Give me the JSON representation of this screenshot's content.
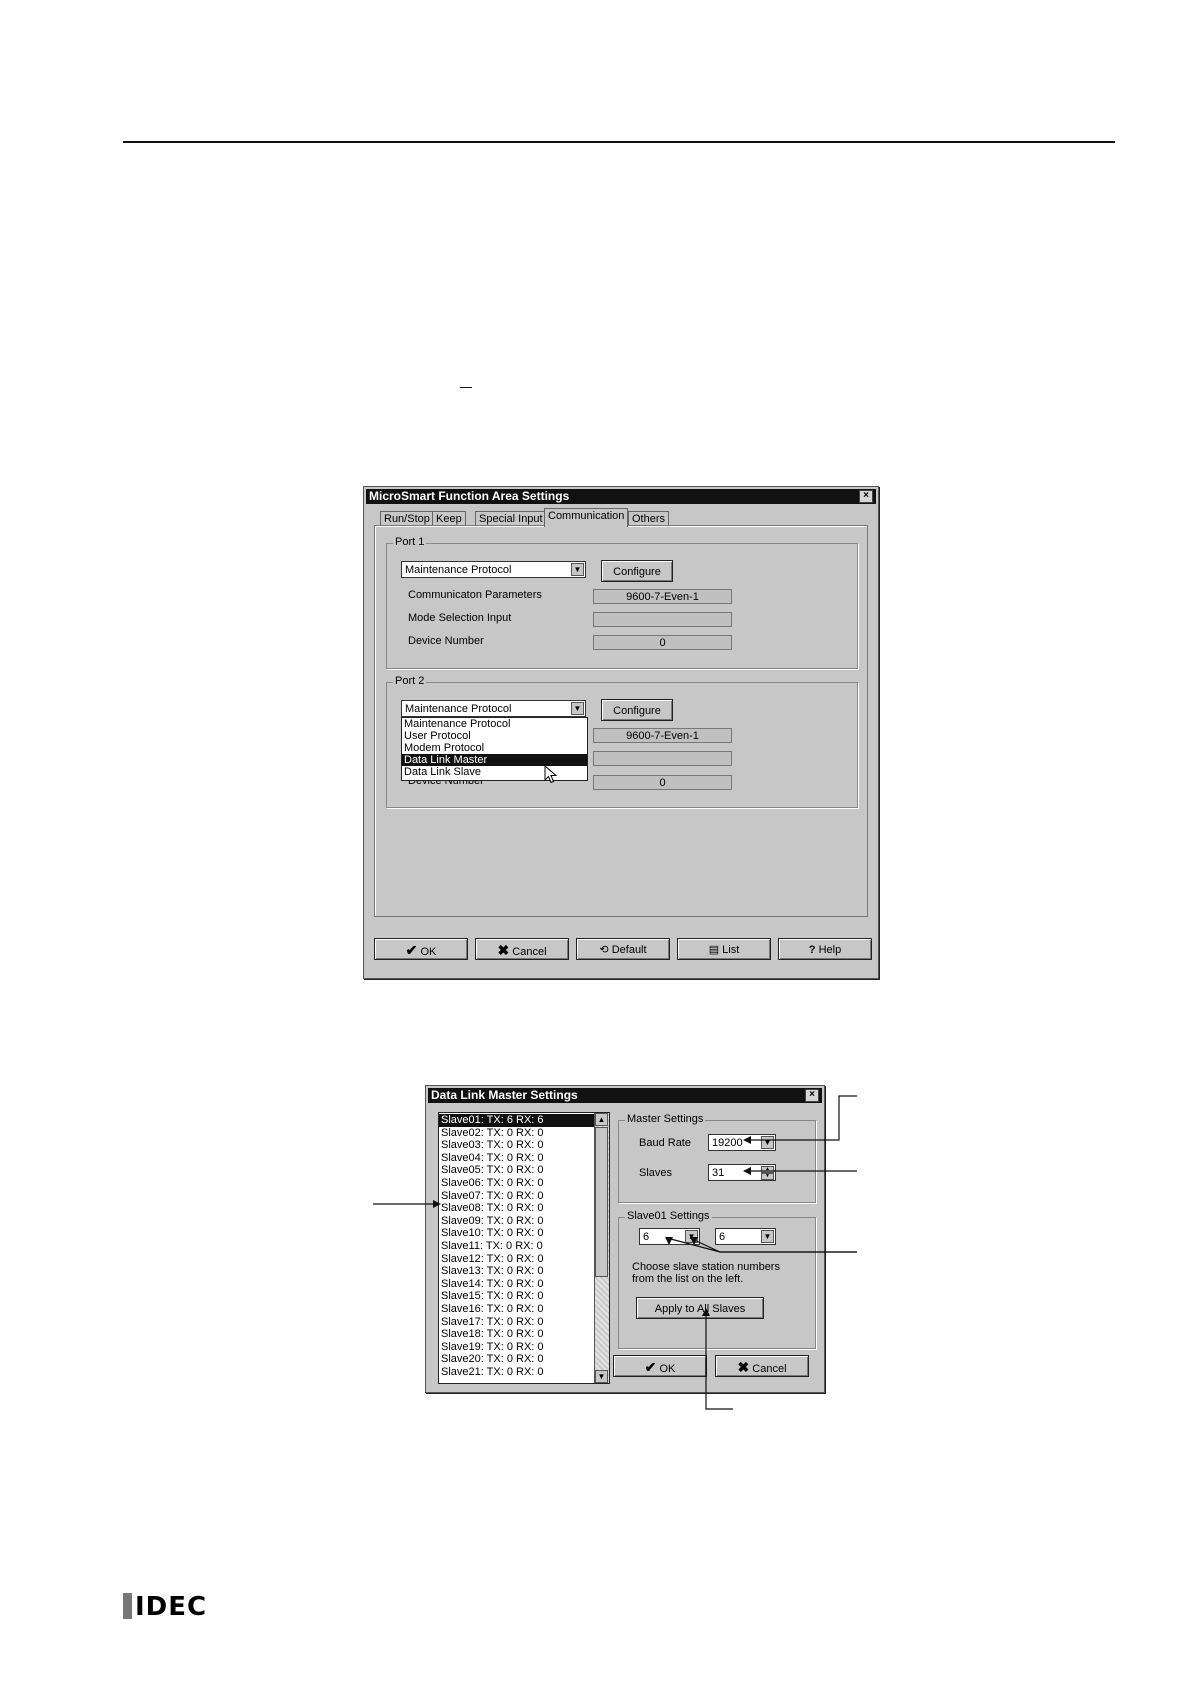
{
  "dialog1": {
    "title": "MicroSmart Function Area Settings",
    "close": "×",
    "tabs": [
      "Run/Stop",
      "Keep",
      "Special Input",
      "Communication",
      "Others"
    ],
    "port1": {
      "label": "Port 1",
      "protocol": "Maintenance Protocol",
      "configure": "Configure",
      "comm_label": "Communicaton Parameters",
      "comm_value": "9600-7-Even-1",
      "mode_label": "Mode Selection Input",
      "mode_value": "",
      "device_label": "Device Number",
      "device_value": "0"
    },
    "port2": {
      "label": "Port 2",
      "protocol": "Maintenance Protocol",
      "configure": "Configure",
      "comm_value": "9600-7-Even-1",
      "device_label": "Device Number",
      "device_value": "0",
      "options": [
        "Maintenance Protocol",
        "User Protocol",
        "Modem Protocol",
        "Data Link Master",
        "Data Link Slave"
      ],
      "highlighted": "Data Link Master"
    },
    "buttons": {
      "ok": "OK",
      "cancel": "Cancel",
      "default": "Default",
      "list": "List",
      "help": "Help"
    }
  },
  "dialog2": {
    "title": "Data Link Master Settings",
    "close": "×",
    "slaves": [
      "Slave01: TX: 6 RX: 6",
      "Slave02: TX: 0 RX: 0",
      "Slave03: TX: 0 RX: 0",
      "Slave04: TX: 0 RX: 0",
      "Slave05: TX: 0 RX: 0",
      "Slave06: TX: 0 RX: 0",
      "Slave07: TX: 0 RX: 0",
      "Slave08: TX: 0 RX: 0",
      "Slave09: TX: 0 RX: 0",
      "Slave10: TX: 0 RX: 0",
      "Slave11: TX: 0 RX: 0",
      "Slave12: TX: 0 RX: 0",
      "Slave13: TX: 0 RX: 0",
      "Slave14: TX: 0 RX: 0",
      "Slave15: TX: 0 RX: 0",
      "Slave16: TX: 0 RX: 0",
      "Slave17: TX: 0 RX: 0",
      "Slave18: TX: 0 RX: 0",
      "Slave19: TX: 0 RX: 0",
      "Slave20: TX: 0 RX: 0",
      "Slave21: TX: 0 RX: 0"
    ],
    "master_settings": {
      "label": "Master Settings",
      "baud_label": "Baud Rate",
      "baud_value": "19200",
      "slaves_label": "Slaves",
      "slaves_value": "31"
    },
    "slave_settings": {
      "label": "Slave01 Settings",
      "tx_value": "6",
      "rx_value": "6",
      "hint_line1": "Choose slave station numbers",
      "hint_line2": "from the list on the left.",
      "apply": "Apply to All Slaves"
    },
    "buttons": {
      "ok": "OK",
      "cancel": "Cancel"
    }
  },
  "footer": {
    "logo": "IDEC"
  }
}
